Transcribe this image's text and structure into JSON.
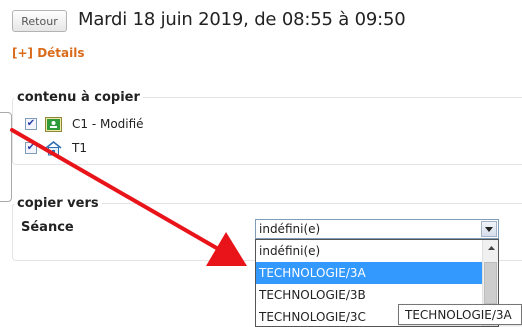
{
  "header": {
    "back_label": "Retour",
    "title": "Mardi 18 juin 2019, de 08:55 à 09:50",
    "details_link": "[+] Détails"
  },
  "content_section": {
    "legend": "contenu à copier",
    "items": [
      {
        "label": "C1 - Modifié",
        "checked": true,
        "icon": "course-icon"
      },
      {
        "label": "T1",
        "checked": true,
        "icon": "home-icon"
      }
    ]
  },
  "copy_section": {
    "legend": "copier vers",
    "seance_label": "Séance",
    "select_value": "indéfini(e)",
    "options": [
      "indéfini(e)",
      "TECHNOLOGIE/3A",
      "TECHNOLOGIE/3B",
      "TECHNOLOGIE/3C"
    ],
    "highlighted_option": "TECHNOLOGIE/3A"
  },
  "tooltip": {
    "text": "TECHNOLOGIE/3A"
  },
  "colors": {
    "accent_orange": "#d96b1b",
    "highlight_blue": "#3399ff",
    "annotation_red": "#e8141a"
  }
}
